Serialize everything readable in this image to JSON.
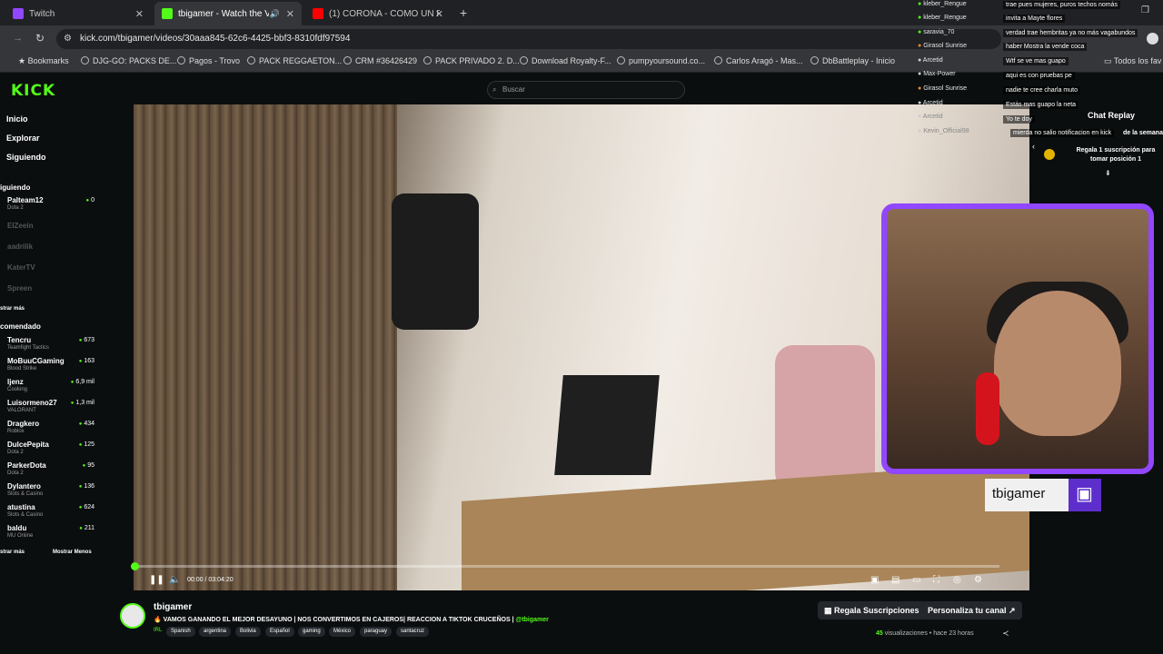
{
  "browser": {
    "tabs": [
      {
        "label": "Twitch",
        "color": "#9146ff"
      },
      {
        "label": "tbigamer - Watch the VOD",
        "color": "#53fc18"
      },
      {
        "label": "(1) CORONA - COMO UN REY",
        "color": "#ff0000"
      }
    ],
    "url": "kick.com/tbigamer/videos/30aaa845-62c6-4425-bbf3-8310fdf97594",
    "bookmarks": [
      "Bookmarks",
      "DJG-GO: PACKS DE...",
      "Pagos - Trovo",
      "PACK REGGAETON...",
      "CRM #36426429",
      "PACK PRIVADO 2. D...",
      "Download Royalty-F...",
      "pumpyoursound.co...",
      "Carlos Aragó - Mas...",
      "DbBattleplay - Inicio"
    ],
    "all_bookmarks": "Todos los fav"
  },
  "kick": {
    "logo": "KICK",
    "search_placeholder": "Buscar",
    "nav": [
      "Inicio",
      "Explorar",
      "Siguiendo"
    ],
    "following_header": "iguiendo",
    "following": [
      {
        "name": "Palteam12",
        "category": "Dota 2",
        "viewers": "0",
        "online": true
      },
      {
        "name": "ElZeein",
        "category": "",
        "viewers": "",
        "online": false
      },
      {
        "name": "aadrilik",
        "category": "",
        "viewers": "",
        "online": false
      },
      {
        "name": "KaterTV",
        "category": "",
        "viewers": "",
        "online": false
      },
      {
        "name": "Spreen",
        "category": "",
        "viewers": "",
        "online": false
      }
    ],
    "show_more_following": "strar más",
    "recommended_header": "comendado",
    "recommended": [
      {
        "name": "Tencru",
        "category": "Teamfight Tactics",
        "viewers": "673"
      },
      {
        "name": "MoBuuCGaming",
        "category": "Blood Strike",
        "viewers": "163"
      },
      {
        "name": "ljenz",
        "category": "Cooking",
        "viewers": "6,9 mil"
      },
      {
        "name": "Luisormeno27",
        "category": "VALORANT",
        "viewers": "1,3 mil"
      },
      {
        "name": "Dragkero",
        "category": "Roblox",
        "viewers": "434"
      },
      {
        "name": "DulcePepita",
        "category": "Dota 2",
        "viewers": "125"
      },
      {
        "name": "ParkerDota",
        "category": "Dota 2",
        "viewers": "95"
      },
      {
        "name": "Dylantero",
        "category": "Slots & Casino",
        "viewers": "136"
      },
      {
        "name": "atustina",
        "category": "Slots & Casino",
        "viewers": "624"
      },
      {
        "name": "baldu",
        "category": "MU Online",
        "viewers": "211"
      }
    ],
    "show_more": "strar más",
    "show_less": "Mostrar Menos"
  },
  "player": {
    "time": "00:00 / 03:04:20",
    "progress": 0.002
  },
  "webcam": {
    "label": "tbigamer",
    "border_color": "#9146ff"
  },
  "chat": {
    "users": [
      {
        "name": "kleber_Rengue"
      },
      {
        "name": "kleber_Rengue"
      },
      {
        "name": "saravia_70"
      },
      {
        "name": "Girasol Sunrise"
      },
      {
        "name": "Arcetid"
      },
      {
        "name": "Max-Power"
      },
      {
        "name": "Girasol Sunrise"
      },
      {
        "name": "Arcetid"
      },
      {
        "name": "Arcetid"
      },
      {
        "name": "Kevin_Official98"
      }
    ],
    "messages": [
      "trae pues mujeres, puros techos nomás",
      "invita a Mayte flores",
      "verdad trae hembritas ya no más vagabundos",
      "haber Mostra la vende coca",
      "Wtf se ve mas guapo",
      "aqui es con pruebas pe",
      "nadie te cree charla muto",
      "Estás mas guapo la neta",
      "Yo te doy",
      "mierda no salio notificacion en kick"
    ],
    "title": "Chat Replay",
    "sub_notice": "Regala 1 suscripción para tomar posición 1",
    "week_label": "de la semana"
  },
  "video": {
    "channel": "tbigamer",
    "title": "VAMOS GANANDO EL MEJOR DESAYUNO | NOS CONVERTIMOS EN CAJEROS| REACCION A TIKTOK CRUCEÑOS |",
    "mention": "@tbigamer",
    "category": "IRL",
    "tags": [
      "Spanish",
      "argentina",
      "Bolivia",
      "Español",
      "gaming",
      "México",
      "paraguay",
      "santacruz"
    ],
    "gift_subs": "Regala Suscripciones",
    "customize": "Personaliza tu canal",
    "views_count": "45",
    "views_label": "visualizaciones",
    "ago": "hace 23 horas"
  }
}
